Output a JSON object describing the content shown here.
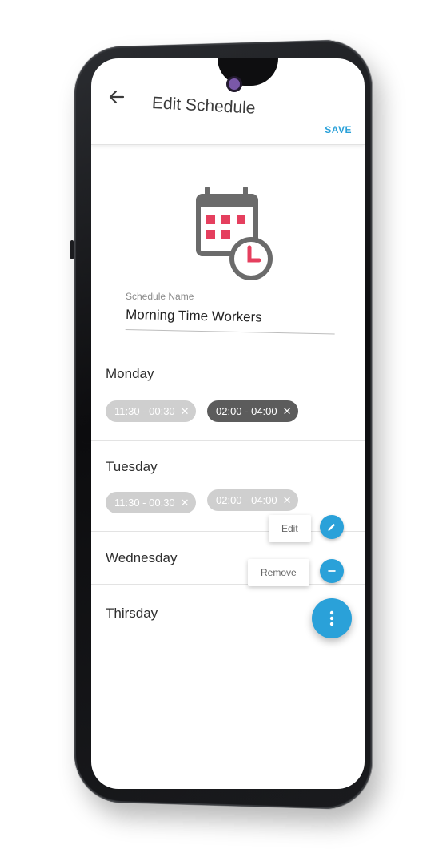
{
  "appbar": {
    "title": "Edit Schedule",
    "save_label": "SAVE"
  },
  "schedule": {
    "name_label": "Schedule Name",
    "name_value": "Morning Time Workers"
  },
  "days": {
    "monday": {
      "label": "Monday",
      "chips": [
        "11:30 - 00:30",
        "02:00 - 04:00"
      ]
    },
    "tuesday": {
      "label": "Tuesday",
      "chips": [
        "11:30 - 00:30",
        "02:00 - 04:00"
      ]
    },
    "wednesday": {
      "label": "Wednesday"
    },
    "thursday": {
      "label": "Thirsday"
    }
  },
  "speed_dial": {
    "edit_label": "Edit",
    "remove_label": "Remove"
  },
  "colors": {
    "accent": "#2aa1d9",
    "calendar_red": "#e53f5e",
    "icon_gray": "#6b6b6b"
  },
  "icons": [
    "arrow-left-icon",
    "calendar-clock-icon",
    "close-icon",
    "pencil-icon",
    "minus-icon",
    "more-vert-icon"
  ]
}
